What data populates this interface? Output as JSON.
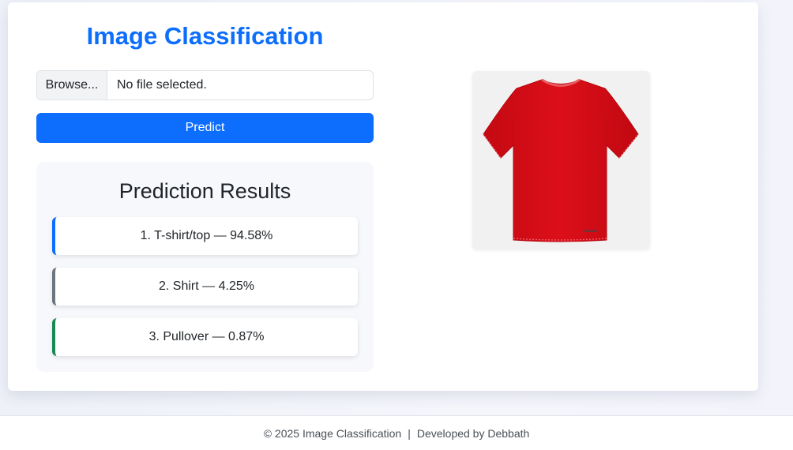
{
  "app": {
    "title": "Image Classification"
  },
  "upload": {
    "browse_label": "Browse...",
    "file_status": "No file selected."
  },
  "predict_button": {
    "label": "Predict"
  },
  "results": {
    "heading": "Prediction Results",
    "items": [
      {
        "text": "1. T-shirt/top — 94.58%",
        "accent": "#0d6efd"
      },
      {
        "text": "2. Shirt — 4.25%",
        "accent": "#6c757d"
      },
      {
        "text": "3. Pullover — 0.87%",
        "accent": "#198754"
      }
    ]
  },
  "preview": {
    "icon": "red-tshirt-image",
    "shirt_color": "#d8101a"
  },
  "footer": {
    "copyright": "© 2025 Image Classification",
    "separator": "|",
    "credit": "Developed by Debbath"
  },
  "colors": {
    "primary": "#0d6efd",
    "secondary": "#6c757d",
    "success": "#198754"
  }
}
